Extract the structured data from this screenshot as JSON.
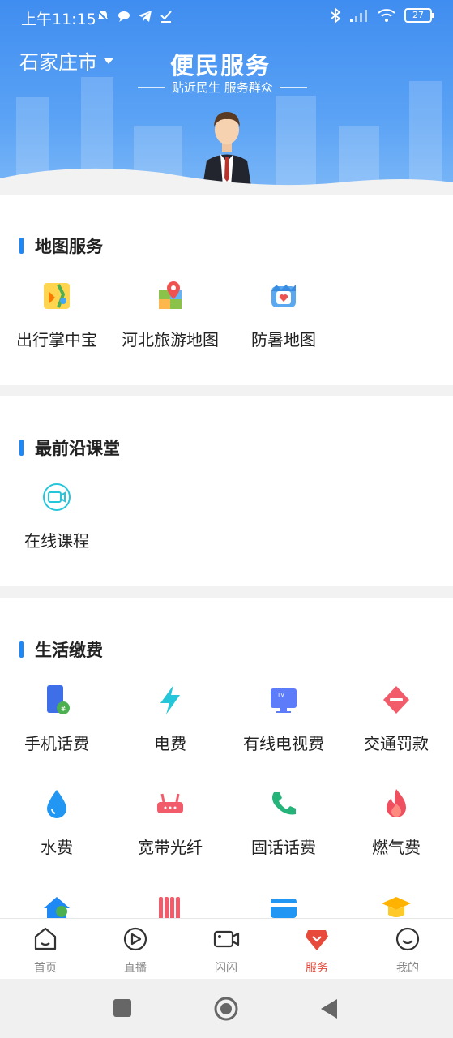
{
  "status_bar": {
    "time": "上午11:15",
    "battery": "27"
  },
  "header": {
    "city": "石家庄市",
    "title": "便民服务",
    "subtitle": "贴近民生 服务群众"
  },
  "sections": [
    {
      "title": "地图服务",
      "items": [
        {
          "label": "出行掌中宝",
          "icon": "travel-map-icon"
        },
        {
          "label": "河北旅游地图",
          "icon": "tourism-map-icon"
        },
        {
          "label": "防暑地图",
          "icon": "heatstroke-map-icon"
        }
      ]
    },
    {
      "title": "最前沿课堂",
      "items": [
        {
          "label": "在线课程",
          "icon": "video-course-icon"
        }
      ]
    },
    {
      "title": "生活缴费",
      "items": [
        {
          "label": "手机话费",
          "icon": "phone-bill-icon"
        },
        {
          "label": "电费",
          "icon": "electricity-icon"
        },
        {
          "label": "有线电视费",
          "icon": "tv-icon"
        },
        {
          "label": "交通罚款",
          "icon": "traffic-fine-icon"
        },
        {
          "label": "水费",
          "icon": "water-drop-icon"
        },
        {
          "label": "宽带光纤",
          "icon": "router-icon"
        },
        {
          "label": "固话话费",
          "icon": "landline-icon"
        },
        {
          "label": "燃气费",
          "icon": "flame-icon"
        }
      ]
    }
  ],
  "bottom_nav": [
    {
      "label": "首页",
      "icon": "home-icon"
    },
    {
      "label": "直播",
      "icon": "live-play-icon"
    },
    {
      "label": "闪闪",
      "icon": "video-camera-icon"
    },
    {
      "label": "服务",
      "icon": "service-icon",
      "active": true
    },
    {
      "label": "我的",
      "icon": "profile-smile-icon"
    }
  ],
  "colors": {
    "accent": "#1e88f5",
    "active_tab": "#e74a3b",
    "banner": "#3f8df0"
  }
}
